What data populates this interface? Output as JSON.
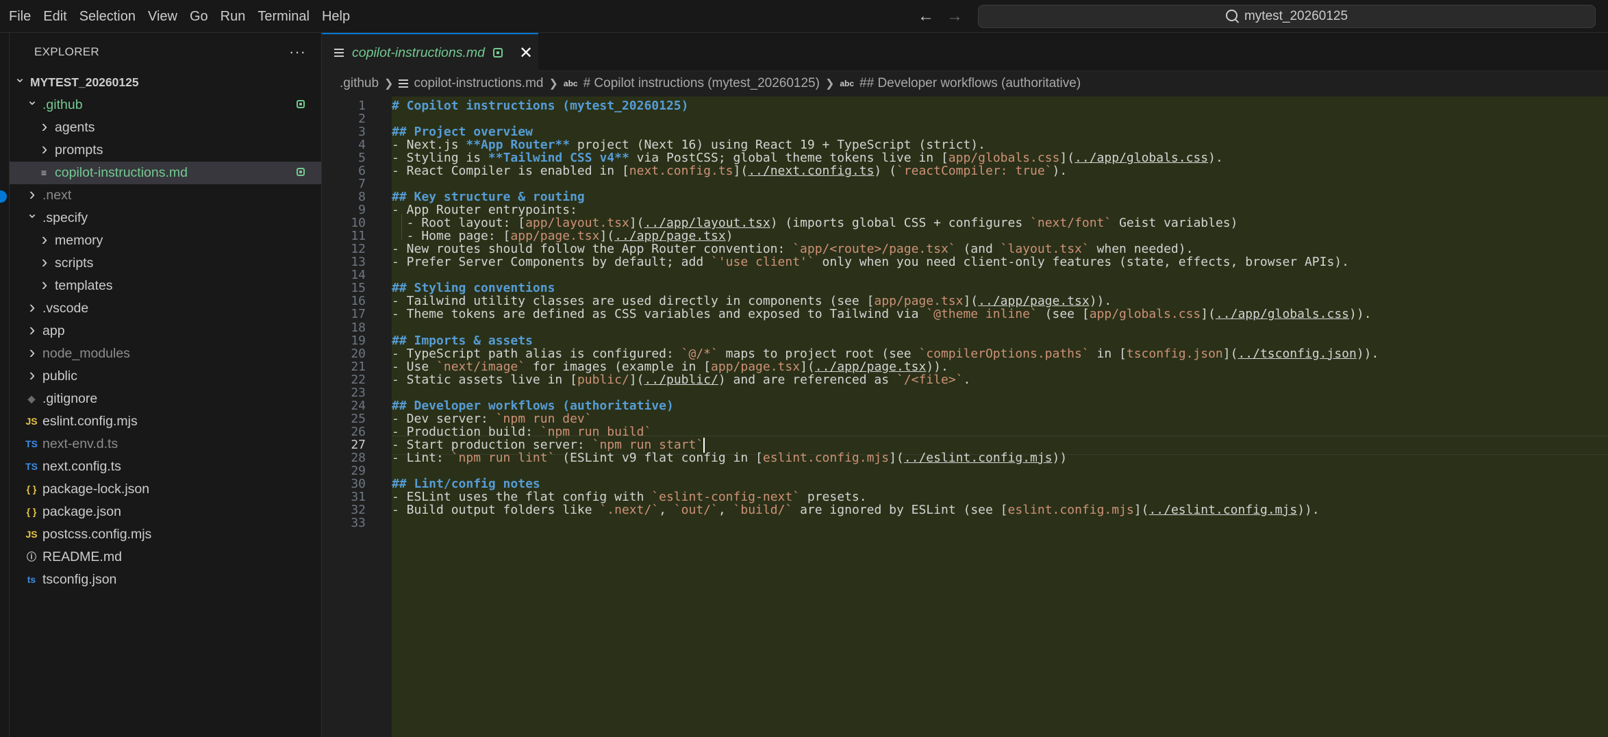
{
  "menu": [
    "File",
    "Edit",
    "Selection",
    "View",
    "Go",
    "Run",
    "Terminal",
    "Help"
  ],
  "search": {
    "text": "mytest_20260125"
  },
  "sidebar": {
    "title": "EXPLORER",
    "more": "···",
    "items": [
      {
        "label": "MYTEST_20260125",
        "depth": 0,
        "kind": "folder-open",
        "root": true
      },
      {
        "label": ".github",
        "depth": 1,
        "kind": "folder-open",
        "style": "green",
        "badge": true
      },
      {
        "label": "agents",
        "depth": 2,
        "kind": "folder"
      },
      {
        "label": "prompts",
        "depth": 2,
        "kind": "folder"
      },
      {
        "label": "copilot-instructions.md",
        "depth": 2,
        "kind": "md",
        "style": "green",
        "badge": true,
        "selected": true
      },
      {
        "label": ".next",
        "depth": 1,
        "kind": "folder",
        "style": "dim"
      },
      {
        "label": ".specify",
        "depth": 1,
        "kind": "folder-open"
      },
      {
        "label": "memory",
        "depth": 2,
        "kind": "folder"
      },
      {
        "label": "scripts",
        "depth": 2,
        "kind": "folder"
      },
      {
        "label": "templates",
        "depth": 2,
        "kind": "folder"
      },
      {
        "label": ".vscode",
        "depth": 1,
        "kind": "folder"
      },
      {
        "label": "app",
        "depth": 1,
        "kind": "folder"
      },
      {
        "label": "node_modules",
        "depth": 1,
        "kind": "folder",
        "style": "dim"
      },
      {
        "label": "public",
        "depth": 1,
        "kind": "folder"
      },
      {
        "label": ".gitignore",
        "depth": 1,
        "kind": "git"
      },
      {
        "label": "eslint.config.mjs",
        "depth": 1,
        "kind": "js"
      },
      {
        "label": "next-env.d.ts",
        "depth": 1,
        "kind": "ts",
        "style": "dim"
      },
      {
        "label": "next.config.ts",
        "depth": 1,
        "kind": "ts"
      },
      {
        "label": "package-lock.json",
        "depth": 1,
        "kind": "json"
      },
      {
        "label": "package.json",
        "depth": 1,
        "kind": "json"
      },
      {
        "label": "postcss.config.mjs",
        "depth": 1,
        "kind": "js"
      },
      {
        "label": "README.md",
        "depth": 1,
        "kind": "info"
      },
      {
        "label": "tsconfig.json",
        "depth": 1,
        "kind": "tsconfig"
      }
    ],
    "icons": {
      "folder": "chevron-right-icon",
      "folder-open": "chevron-down-icon",
      "md": "markdown-icon",
      "git": "git-file-icon",
      "js": "js-file-icon",
      "ts": "ts-file-icon",
      "json": "json-file-icon",
      "info": "info-icon",
      "tsconfig": "tsconfig-file-icon"
    }
  },
  "editor": {
    "tab": {
      "title": "copilot-instructions.md",
      "close": "✕"
    },
    "breadcrumbs": [
      ".github",
      "copilot-instructions.md",
      "# Copilot instructions (mytest_20260125)",
      "## Developer workflows (authoritative)"
    ],
    "active_line": 27,
    "lines": [
      [
        [
          "h",
          "# Copilot instructions (mytest_20260125)"
        ]
      ],
      [],
      [
        [
          "h",
          "## Project overview"
        ]
      ],
      [
        [
          "t",
          "- Next.js "
        ],
        [
          "b",
          "**App Router**"
        ],
        [
          "t",
          " project (Next 16) using React 19 + TypeScript (strict)."
        ]
      ],
      [
        [
          "t",
          "- Styling is "
        ],
        [
          "b",
          "**Tailwind CSS v4**"
        ],
        [
          "t",
          " via PostCSS; global theme tokens live in ["
        ],
        [
          "c",
          "app/globals.css"
        ],
        [
          "t",
          "]("
        ],
        [
          "u",
          "../app/globals.css"
        ],
        [
          "t",
          ")."
        ]
      ],
      [
        [
          "t",
          "- React Compiler is enabled in ["
        ],
        [
          "c",
          "next.config.ts"
        ],
        [
          "t",
          "]("
        ],
        [
          "u",
          "../next.config.ts"
        ],
        [
          "t",
          ") ("
        ],
        [
          "c",
          "`reactCompiler: true`"
        ],
        [
          "t",
          ")."
        ]
      ],
      [],
      [
        [
          "h",
          "## Key structure & routing"
        ]
      ],
      [
        [
          "t",
          "- App Router entrypoints:"
        ]
      ],
      [
        [
          "t",
          "  - Root layout: ["
        ],
        [
          "c",
          "app/layout.tsx"
        ],
        [
          "t",
          "]("
        ],
        [
          "u",
          "../app/layout.tsx"
        ],
        [
          "t",
          ") (imports global CSS + configures "
        ],
        [
          "c",
          "`next/font`"
        ],
        [
          "t",
          " Geist variables)"
        ]
      ],
      [
        [
          "t",
          "  - Home page: ["
        ],
        [
          "c",
          "app/page.tsx"
        ],
        [
          "t",
          "]("
        ],
        [
          "u",
          "../app/page.tsx"
        ],
        [
          "t",
          ")"
        ]
      ],
      [
        [
          "t",
          "- New routes should follow the App Router convention: "
        ],
        [
          "c",
          "`app/<route>/page.tsx`"
        ],
        [
          "t",
          " (and "
        ],
        [
          "c",
          "`layout.tsx`"
        ],
        [
          "t",
          " when needed)."
        ]
      ],
      [
        [
          "t",
          "- Prefer Server Components by default; add "
        ],
        [
          "c",
          "`'use client'`"
        ],
        [
          "t",
          " only when you need client-only features (state, effects, browser APIs)."
        ]
      ],
      [],
      [
        [
          "h",
          "## Styling conventions"
        ]
      ],
      [
        [
          "t",
          "- Tailwind utility classes are used directly in components (see ["
        ],
        [
          "c",
          "app/page.tsx"
        ],
        [
          "t",
          "]("
        ],
        [
          "u",
          "../app/page.tsx"
        ],
        [
          "t",
          "))."
        ]
      ],
      [
        [
          "t",
          "- Theme tokens are defined as CSS variables and exposed to Tailwind via "
        ],
        [
          "c",
          "`@theme inline`"
        ],
        [
          "t",
          " (see ["
        ],
        [
          "c",
          "app/globals.css"
        ],
        [
          "t",
          "]("
        ],
        [
          "u",
          "../app/globals.css"
        ],
        [
          "t",
          "))."
        ]
      ],
      [],
      [
        [
          "h",
          "## Imports & assets"
        ]
      ],
      [
        [
          "t",
          "- TypeScript path alias is configured: "
        ],
        [
          "c",
          "`@/*`"
        ],
        [
          "t",
          " maps to project root (see "
        ],
        [
          "c",
          "`compilerOptions.paths`"
        ],
        [
          "t",
          " in ["
        ],
        [
          "c",
          "tsconfig.json"
        ],
        [
          "t",
          "]("
        ],
        [
          "u",
          "../tsconfig.json"
        ],
        [
          "t",
          "))."
        ]
      ],
      [
        [
          "t",
          "- Use "
        ],
        [
          "c",
          "`next/image`"
        ],
        [
          "t",
          " for images (example in ["
        ],
        [
          "c",
          "app/page.tsx"
        ],
        [
          "t",
          "]("
        ],
        [
          "u",
          "../app/page.tsx"
        ],
        [
          "t",
          "))."
        ]
      ],
      [
        [
          "t",
          "- Static assets live in ["
        ],
        [
          "c",
          "public/"
        ],
        [
          "t",
          "]("
        ],
        [
          "u",
          "../public/"
        ],
        [
          "t",
          ") and are referenced as "
        ],
        [
          "c",
          "`/<file>`"
        ],
        [
          "t",
          "."
        ]
      ],
      [],
      [
        [
          "h",
          "## Developer workflows (authoritative)"
        ]
      ],
      [
        [
          "t",
          "- Dev server: "
        ],
        [
          "c",
          "`npm run dev`"
        ]
      ],
      [
        [
          "t",
          "- Production build: "
        ],
        [
          "c",
          "`npm run build`"
        ]
      ],
      [
        [
          "t",
          "- Start production server: "
        ],
        [
          "c",
          "`npm run start`"
        ],
        [
          "caret",
          ""
        ]
      ],
      [
        [
          "t",
          "- Lint: "
        ],
        [
          "c",
          "`npm run lint`"
        ],
        [
          "t",
          " (ESLint v9 flat config in ["
        ],
        [
          "c",
          "eslint.config.mjs"
        ],
        [
          "t",
          "]("
        ],
        [
          "u",
          "../eslint.config.mjs"
        ],
        [
          "t",
          "))"
        ]
      ],
      [],
      [
        [
          "h",
          "## Lint/config notes"
        ]
      ],
      [
        [
          "t",
          "- ESLint uses the flat config with "
        ],
        [
          "c",
          "`eslint-config-next`"
        ],
        [
          "t",
          " presets."
        ]
      ],
      [
        [
          "t",
          "- Build output folders like "
        ],
        [
          "c",
          "`.next/`"
        ],
        [
          "t",
          ", "
        ],
        [
          "c",
          "`out/`"
        ],
        [
          "t",
          ", "
        ],
        [
          "c",
          "`build/`"
        ],
        [
          "t",
          " are ignored by ESLint (see ["
        ],
        [
          "c",
          "eslint.config.mjs"
        ],
        [
          "t",
          "]("
        ],
        [
          "u",
          "../eslint.config.mjs"
        ],
        [
          "t",
          "))."
        ]
      ],
      []
    ]
  },
  "colors": {
    "accent": "#0078d4",
    "git_added": "#73c991",
    "heading": "#569cd6",
    "string": "#ce9178",
    "editor_bg": "#2a3118"
  }
}
